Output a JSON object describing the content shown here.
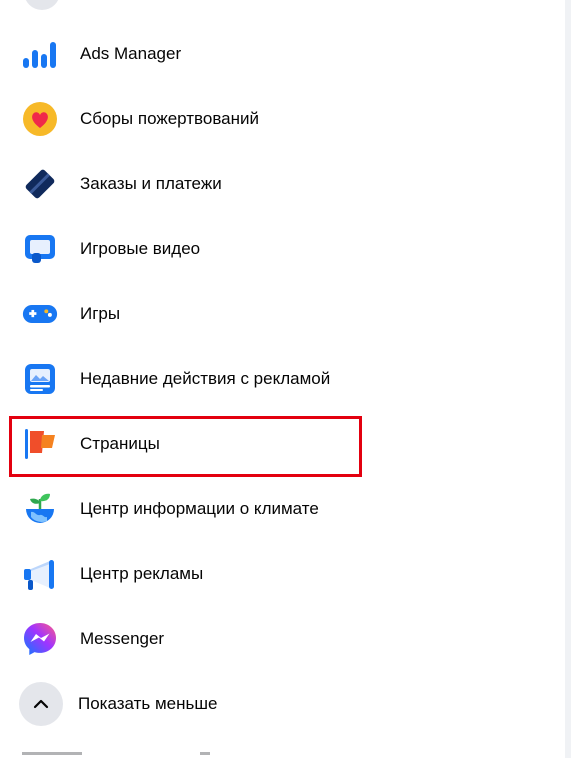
{
  "menu": {
    "items": [
      {
        "label": "Ads Manager",
        "icon": "ads-manager-bar-chart-icon"
      },
      {
        "label": "Сборы пожертвований",
        "icon": "heart-donation-icon"
      },
      {
        "label": "Заказы и платежи",
        "icon": "payment-card-icon"
      },
      {
        "label": "Игровые видео",
        "icon": "gaming-video-icon"
      },
      {
        "label": "Игры",
        "icon": "gamepad-icon"
      },
      {
        "label": "Недавние действия с рекламой",
        "icon": "recent-ad-activity-icon"
      },
      {
        "label": "Страницы",
        "icon": "pages-flag-icon"
      },
      {
        "label": "Центр информации о климате",
        "icon": "climate-sprout-globe-icon"
      },
      {
        "label": "Центр рекламы",
        "icon": "megaphone-icon"
      },
      {
        "label": "Messenger",
        "icon": "messenger-icon"
      }
    ],
    "show_less_label": "Показать меньше"
  },
  "colors": {
    "highlight_box": "#e3000f",
    "primary_blue": "#0866ff",
    "text": "#050505"
  }
}
